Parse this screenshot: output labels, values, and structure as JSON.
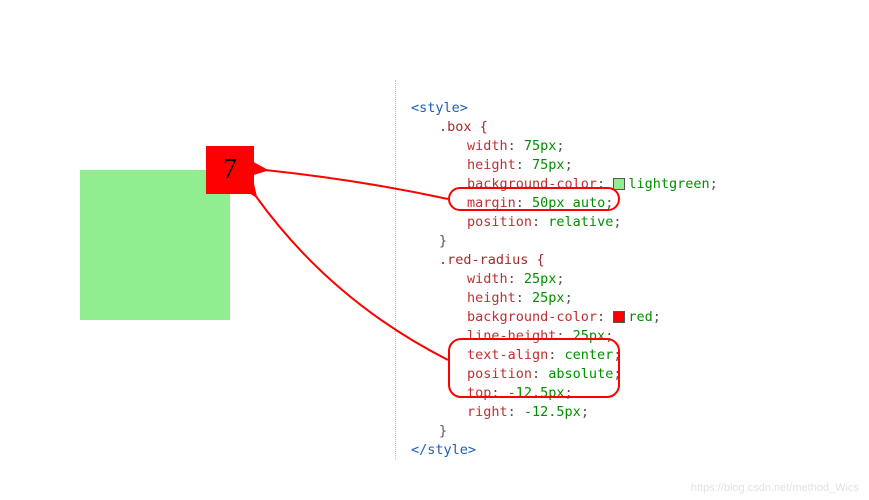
{
  "demo": {
    "box_number": "7"
  },
  "code": {
    "open_tag": "<style>",
    "close_tag": "</style>",
    "box_selector": ".box {",
    "box_props": {
      "width": {
        "k": "width",
        "v": "75px"
      },
      "height": {
        "k": "height",
        "v": "75px"
      },
      "bg": {
        "k": "background-color",
        "v": "lightgreen"
      },
      "margin": {
        "k": "margin",
        "v": "50px auto"
      },
      "pos": {
        "k": "position",
        "v": "relative"
      }
    },
    "box_close": "}",
    "red_selector": ".red-radius {",
    "red_props": {
      "width": {
        "k": "width",
        "v": "25px"
      },
      "height": {
        "k": "height",
        "v": "25px"
      },
      "bg": {
        "k": "background-color",
        "v": "red"
      },
      "lh": {
        "k": "line-height",
        "v": "25px"
      },
      "ta": {
        "k": "text-align",
        "v": "center"
      },
      "pos": {
        "k": "position",
        "v": "absolute"
      },
      "top": {
        "k": "top",
        "v": "-12.5px"
      },
      "right": {
        "k": "right",
        "v": "-12.5px"
      }
    },
    "red_close": "}"
  },
  "watermark": "https://blog.csdn.net/method_Wics"
}
